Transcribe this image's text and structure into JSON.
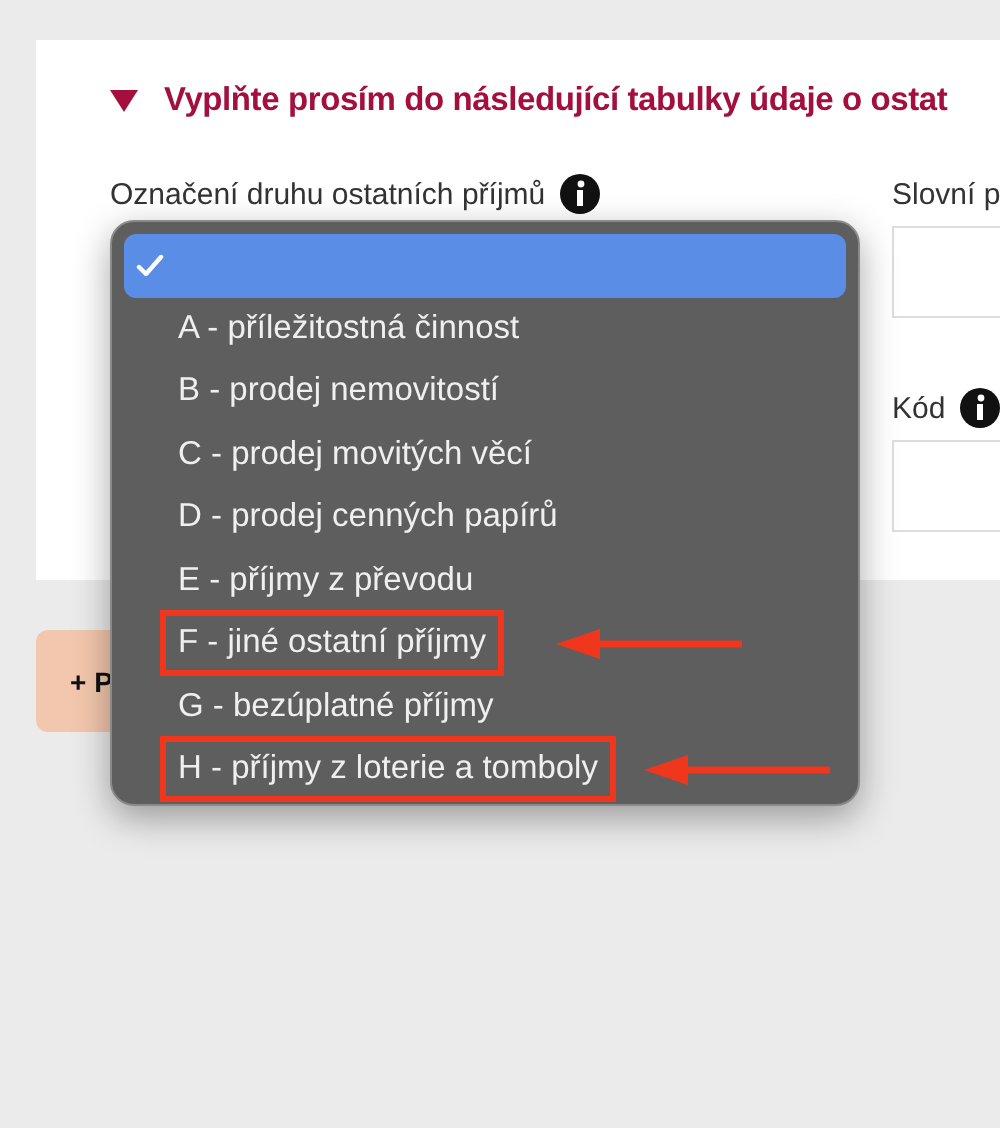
{
  "section": {
    "expanded": true,
    "title": "Vyplňte prosím do následující tabulky údaje o ostat"
  },
  "fields": [
    {
      "label": "Označení druhu ostatních příjmů",
      "info": true
    },
    {
      "label": "Slovní p",
      "info": false
    },
    {
      "label": "Kód",
      "info": true
    }
  ],
  "add_button": {
    "label": "+ P"
  },
  "dropdown": {
    "items": [
      {
        "selected": true,
        "highlighted": false
      },
      {
        "label": "A - příležitostná činnost",
        "selected": false,
        "highlighted": false
      },
      {
        "label": "B - prodej nemovitostí",
        "selected": false,
        "highlighted": false
      },
      {
        "label": "C - prodej movitých věcí",
        "selected": false,
        "highlighted": false
      },
      {
        "label": "D - prodej cenných papírů",
        "selected": false,
        "highlighted": false
      },
      {
        "label": "E - příjmy z převodu",
        "selected": false,
        "highlighted": false
      },
      {
        "label": "F - jiné ostatní příjmy",
        "selected": false,
        "highlighted": true
      },
      {
        "label": "G - bezúplatné příjmy",
        "selected": false,
        "highlighted": false
      },
      {
        "label": "H - příjmy z loterie a tomboly",
        "selected": false,
        "highlighted": true
      }
    ]
  }
}
